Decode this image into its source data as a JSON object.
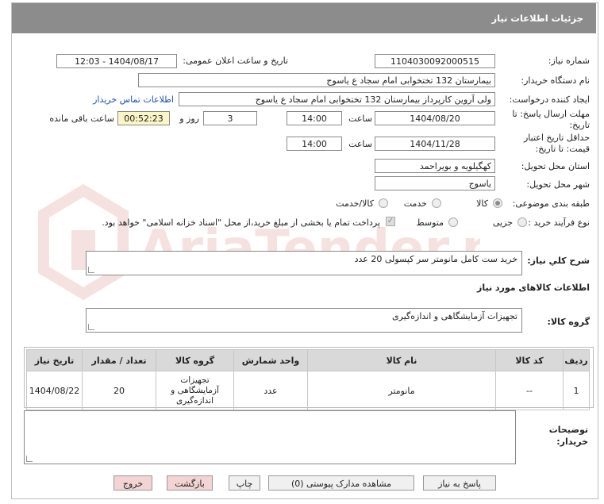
{
  "header": {
    "title": "جزئیات اطلاعات نیاز"
  },
  "fields": {
    "need_number_label": "شماره نیاز:",
    "need_number": "1104030092000515",
    "announce_label": "تاریخ و ساعت اعلان عمومی:",
    "announce_value": "1404/08/17 - 12:03",
    "buyer_org_label": "نام دستگاه خریدار:",
    "buyer_org": "بیمارستان 132 تختخوابی امام سجاد  ع  یاسوج",
    "creator_label": "ایجاد کننده درخواست:",
    "creator": "ولی آروین کارپرداز بیمارستان 132 تختخوابی امام سجاد  ع  یاسوج",
    "contact_link": "اطلاعات تماس خریدار",
    "deadline_label_1": "مهلت ارسال پاسخ: تا",
    "deadline_label_2": "تاریخ:",
    "deadline_date": "1404/08/20",
    "time_label": "ساعت",
    "deadline_time": "14:00",
    "days_value": "3",
    "days_label": "روز و",
    "remaining_time": "00:52:23",
    "remaining_label": "ساعت باقی مانده",
    "validity_label_1": "حداقل تاریخ اعتبار",
    "validity_label_2": "قیمت: تا تاریخ:",
    "validity_date": "1404/11/28",
    "validity_time": "14:00",
    "province_label": "استان محل تحویل:",
    "province": "کهگیلویه و بویراحمد",
    "city_label": "شهر محل تحویل:",
    "city": "یاسوج",
    "category_label": "طبقه بندی موضوعی:",
    "category_options": [
      "کالا",
      "خدمت",
      "کالا/خدمت"
    ],
    "purchase_type_label": "نوع فرآیند خرید :",
    "purchase_options": [
      "جزیی",
      "متوسط"
    ],
    "payment_note": "پرداخت تمام یا بخشی از مبلغ خرید،از محل \"اسناد خزانه اسلامی\" خواهد بود.",
    "description_label": "شرح کلي نیاز:",
    "description": "خرید  ست کامل  مانومتر  سر کپسولی 20 عدد",
    "goods_info_title": "اطلاعات کالاهای مورد نیاز",
    "goods_group_label": "گروه کالا:",
    "goods_group": "تجهیزات آزمایشگاهی و اندازه‌گیری",
    "buyer_notes_label_1": "توضیحات",
    "buyer_notes_label_2": "خریدار:"
  },
  "table": {
    "headers": [
      "ردیف",
      "کد کالا",
      "نام کالا",
      "واحد شمارش",
      "گروه کالا",
      "تعداد / مقدار",
      "تاریخ نیاز"
    ],
    "rows": [
      [
        "1",
        "--",
        "مانومتر",
        "عدد",
        "تجهیزات آزمایشگاهی و اندازه‌گیری",
        "20",
        "1404/08/22"
      ]
    ]
  },
  "buttons": {
    "reply": "پاسخ به نیاز",
    "docs": "مشاهده مدارک پیوستی (0)",
    "print": "چاپ",
    "back": "بازگشت",
    "exit": "خروج"
  },
  "watermark": {
    "text": "AriaTender.net"
  },
  "colors": {
    "header_bg": "#8c8c8c",
    "link": "#1a4fc0",
    "remaining_bg": "#fbf6c6",
    "exit_bg": "#f3d3d3"
  }
}
